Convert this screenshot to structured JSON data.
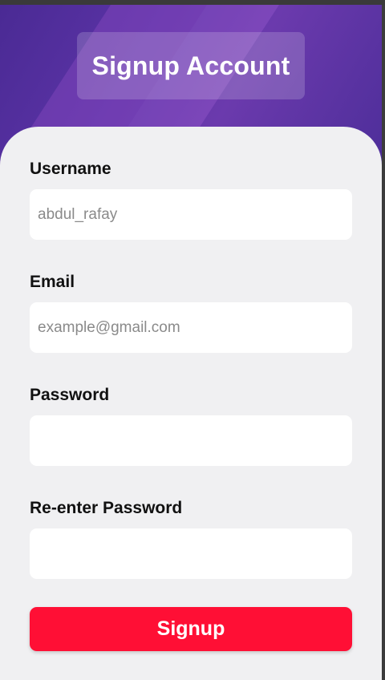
{
  "header": {
    "title": "Signup Account"
  },
  "form": {
    "username": {
      "label": "Username",
      "placeholder": "abdul_rafay",
      "value": ""
    },
    "email": {
      "label": "Email",
      "placeholder": "example@gmail.com",
      "value": ""
    },
    "password": {
      "label": "Password",
      "placeholder": "",
      "value": ""
    },
    "reenter_password": {
      "label": "Re-enter Password",
      "placeholder": "",
      "value": ""
    },
    "submit_label": "Signup"
  },
  "colors": {
    "header_gradient_start": "#4a2a94",
    "header_gradient_mid": "#6b3aad",
    "card_background": "#f0f0f2",
    "input_background": "#ffffff",
    "button_background": "#ff0f35",
    "button_text": "#ffffff"
  }
}
